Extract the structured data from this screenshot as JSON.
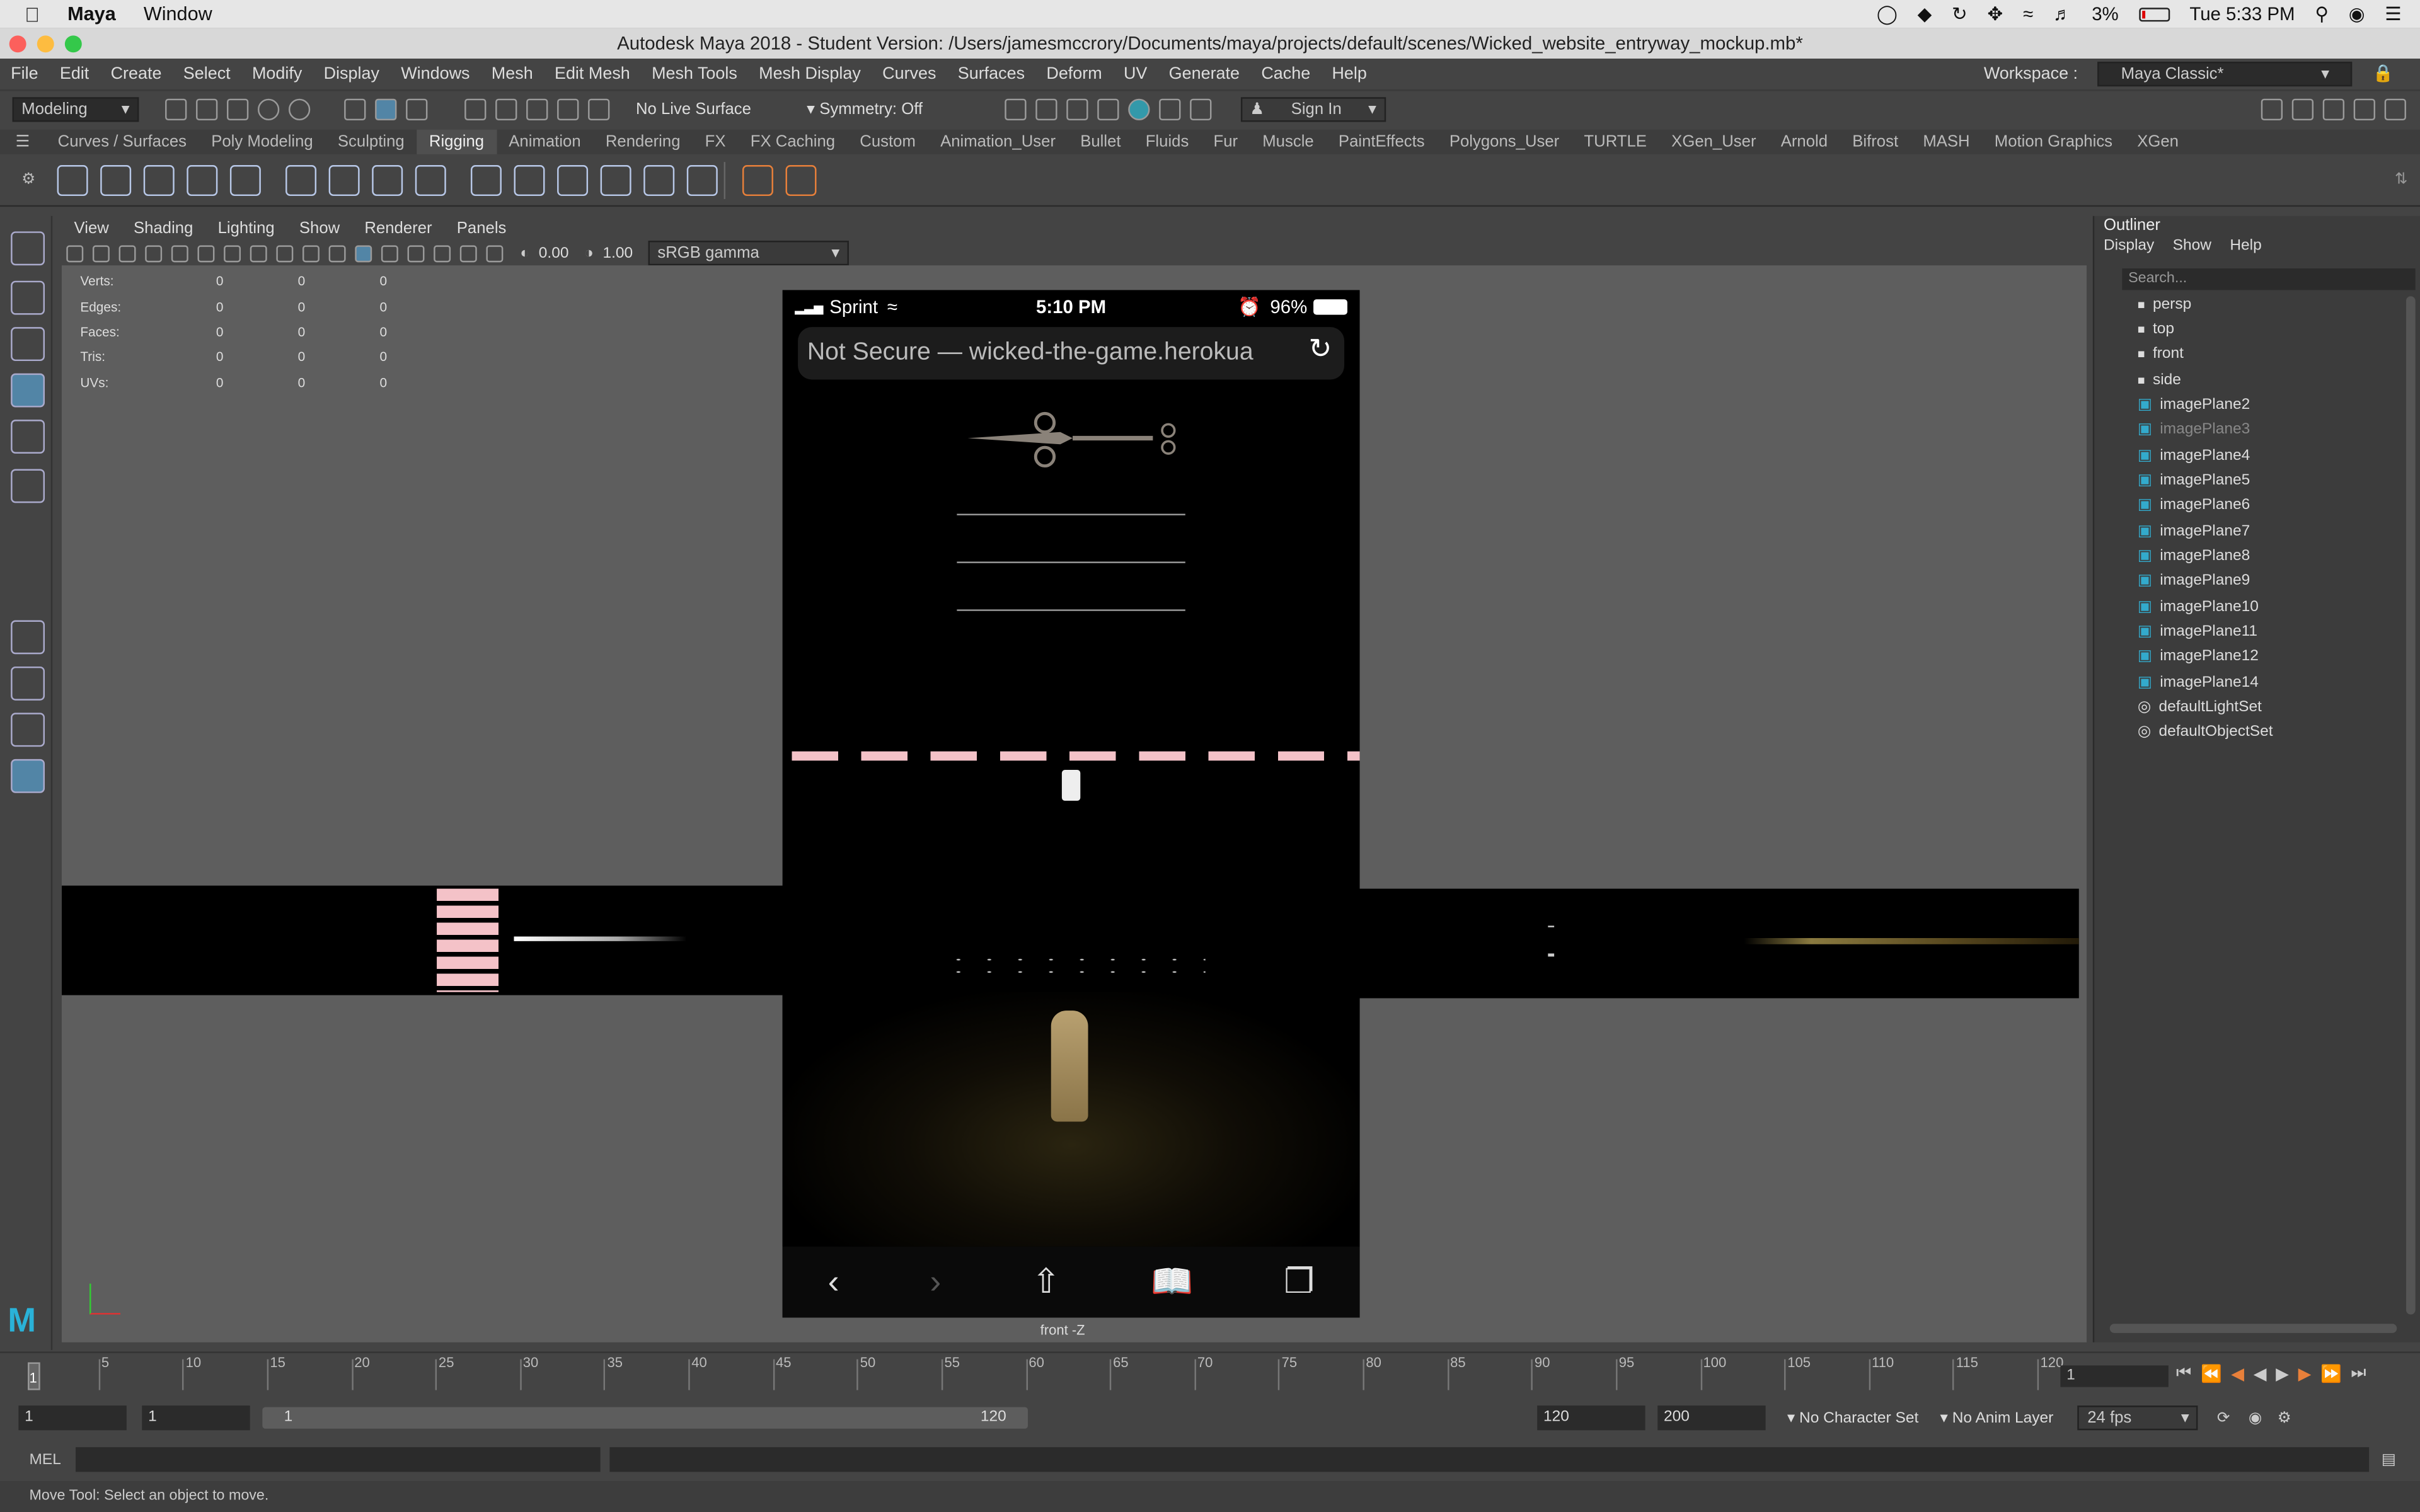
{
  "mac_menubar": {
    "app_name": "Maya",
    "menus": [
      "Window"
    ],
    "battery": "3%",
    "clock": "Tue 5:33 PM"
  },
  "window": {
    "title": "Autodesk Maya 2018 - Student Version: /Users/jamesmccrory/Documents/maya/projects/default/scenes/Wicked_website_entryway_mockup.mb*"
  },
  "main_menu": [
    "File",
    "Edit",
    "Create",
    "Select",
    "Modify",
    "Display",
    "Windows",
    "Mesh",
    "Edit Mesh",
    "Mesh Tools",
    "Mesh Display",
    "Curves",
    "Surfaces",
    "Deform",
    "UV",
    "Generate",
    "Cache",
    "Help"
  ],
  "workspace": {
    "label": "Workspace :",
    "value": "Maya Classic*"
  },
  "status_line": {
    "menu_set": "Modeling",
    "live_surface": "No Live Surface",
    "symmetry": "Symmetry: Off",
    "sign_in": "Sign In"
  },
  "shelf_tabs": [
    "Curves / Surfaces",
    "Poly Modeling",
    "Sculpting",
    "Rigging",
    "Animation",
    "Rendering",
    "FX",
    "FX Caching",
    "Custom",
    "Animation_User",
    "Bullet",
    "Fluids",
    "Fur",
    "Muscle",
    "PaintEffects",
    "Polygons_User",
    "TURTLE",
    "XGen_User",
    "Arnold",
    "Bifrost",
    "MASH",
    "Motion Graphics",
    "XGen"
  ],
  "active_shelf_tab": "Rigging",
  "panel_menu": [
    "View",
    "Shading",
    "Lighting",
    "Show",
    "Renderer",
    "Panels"
  ],
  "panel_toolbar": {
    "exposure": "0.00",
    "gamma": "1.00",
    "color_space": "sRGB gamma"
  },
  "hud": {
    "rows": [
      {
        "label": "Verts:",
        "v1": "0",
        "v2": "0",
        "v3": "0"
      },
      {
        "label": "Edges:",
        "v1": "0",
        "v2": "0",
        "v3": "0"
      },
      {
        "label": "Faces:",
        "v1": "0",
        "v2": "0",
        "v3": "0"
      },
      {
        "label": "Tris:",
        "v1": "0",
        "v2": "0",
        "v3": "0"
      },
      {
        "label": "UVs:",
        "v1": "0",
        "v2": "0",
        "v3": "0"
      }
    ]
  },
  "phone": {
    "carrier": "Sprint",
    "time": "5:10 PM",
    "battery": "96%",
    "url_text": "Not Secure — wicked-the-game.herokua"
  },
  "viewport_label": "front -Z",
  "outliner": {
    "title": "Outliner",
    "menu": [
      "Display",
      "Show",
      "Help"
    ],
    "search_placeholder": "Search...",
    "items": [
      {
        "name": "persp",
        "type": "camera"
      },
      {
        "name": "top",
        "type": "camera"
      },
      {
        "name": "front",
        "type": "camera"
      },
      {
        "name": "side",
        "type": "camera"
      },
      {
        "name": "imagePlane2",
        "type": "plane"
      },
      {
        "name": "imagePlane3",
        "type": "plane",
        "dim": true
      },
      {
        "name": "imagePlane4",
        "type": "plane"
      },
      {
        "name": "imagePlane5",
        "type": "plane"
      },
      {
        "name": "imagePlane6",
        "type": "plane"
      },
      {
        "name": "imagePlane7",
        "type": "plane"
      },
      {
        "name": "imagePlane8",
        "type": "plane"
      },
      {
        "name": "imagePlane9",
        "type": "plane"
      },
      {
        "name": "imagePlane10",
        "type": "plane"
      },
      {
        "name": "imagePlane11",
        "type": "plane"
      },
      {
        "name": "imagePlane12",
        "type": "plane"
      },
      {
        "name": "imagePlane14",
        "type": "plane"
      },
      {
        "name": "defaultLightSet",
        "type": "set"
      },
      {
        "name": "defaultObjectSet",
        "type": "set"
      }
    ]
  },
  "timeline": {
    "ticks": [
      "5",
      "10",
      "15",
      "20",
      "25",
      "30",
      "35",
      "40",
      "45",
      "50",
      "55",
      "60",
      "65",
      "70",
      "75",
      "80",
      "85",
      "90",
      "95",
      "100",
      "105",
      "110",
      "115",
      "120"
    ],
    "current_frame_marker": "1",
    "current_frame_field": "1"
  },
  "range_slider": {
    "start": "1",
    "start_inner": "1",
    "slider_start": "1",
    "slider_end": "120",
    "end": "120",
    "end_outer": "200",
    "character_set": "No Character Set",
    "anim_layer": "No Anim Layer",
    "fps": "24 fps"
  },
  "command_line": {
    "label": "MEL"
  },
  "help_line": "Move Tool: Select an object to move."
}
